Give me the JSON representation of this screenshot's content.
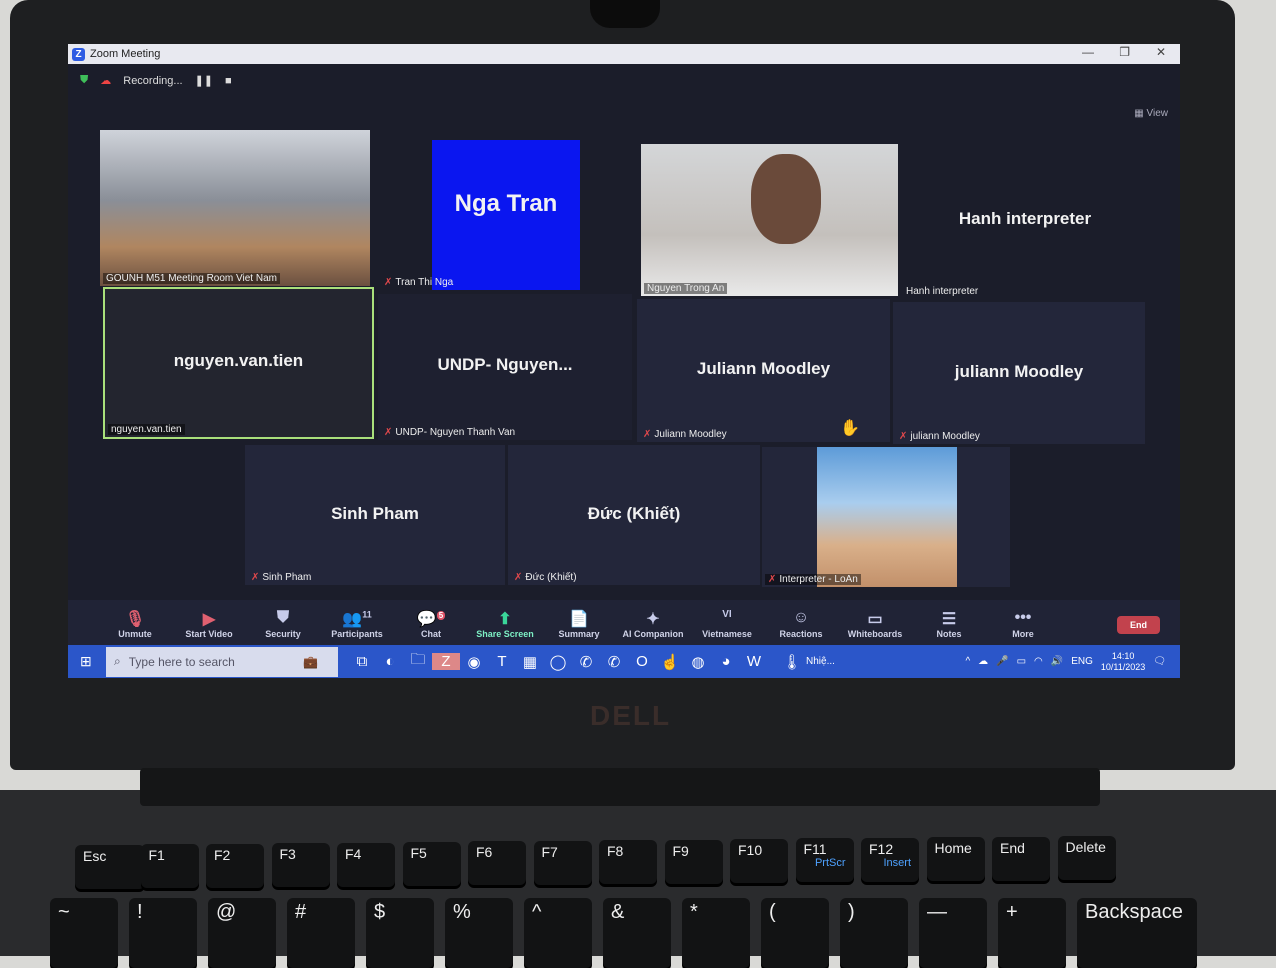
{
  "window": {
    "title": "Zoom Meeting",
    "recording": "Recording...",
    "view_label": "View"
  },
  "tiles": [
    {
      "name": "",
      "label": "GOUNH M51 Meeting Room Viet Nam"
    },
    {
      "name": "Nga Tran",
      "label": "Tran Thi Nga"
    },
    {
      "name": "",
      "label": "Nguyen Trong An"
    },
    {
      "name": "Hanh interpreter",
      "label": "Hanh interpreter"
    },
    {
      "name": "nguyen.van.tien",
      "label": "nguyen.van.tien"
    },
    {
      "name": "UNDP-  Nguyen...",
      "label": "UNDP- Nguyen Thanh Van"
    },
    {
      "name": "Juliann Moodley",
      "label": "Juliann Moodley"
    },
    {
      "name": "juliann Moodley",
      "label": "juliann Moodley"
    },
    {
      "name": "Sinh Pham",
      "label": "Sinh Pham"
    },
    {
      "name": "Đức (Khiết)",
      "label": "Đức (Khiết)"
    },
    {
      "name": "",
      "label": "Interpreter - LoAn"
    }
  ],
  "toolbar": {
    "items": [
      {
        "label": "Unmute",
        "icon": "mic-muted-icon"
      },
      {
        "label": "Start Video",
        "icon": "video-off-icon"
      },
      {
        "label": "Security",
        "icon": "shield-icon"
      },
      {
        "label": "Participants",
        "icon": "participants-icon",
        "count": "11"
      },
      {
        "label": "Chat",
        "icon": "chat-icon",
        "badge": "5"
      },
      {
        "label": "Share Screen",
        "icon": "share-icon"
      },
      {
        "label": "Summary",
        "icon": "summary-icon"
      },
      {
        "label": "AI Companion",
        "icon": "sparkle-icon"
      },
      {
        "label": "Vietnamese",
        "icon": "language-icon",
        "badge": "VI"
      },
      {
        "label": "Reactions",
        "icon": "reactions-icon"
      },
      {
        "label": "Whiteboards",
        "icon": "whiteboard-icon"
      },
      {
        "label": "Notes",
        "icon": "notes-icon"
      },
      {
        "label": "More",
        "icon": "more-icon"
      }
    ],
    "end_label": "End"
  },
  "taskbar": {
    "search_placeholder": "Type here to search",
    "weather": "Nhiệ...",
    "lang": "ENG",
    "time": "14:10",
    "date": "10/11/2023"
  },
  "laptop": {
    "brand": "DELL"
  },
  "keyboard": {
    "frow": [
      "Esc",
      "F1",
      "F2",
      "F3",
      "F4",
      "F5",
      "F6",
      "F7",
      "F8",
      "F9",
      "F10",
      "F11",
      "F12",
      "Home",
      "End",
      "Delete"
    ],
    "frow_sub": [
      "",
      "",
      "",
      "",
      "",
      "",
      "",
      "",
      "",
      "",
      "",
      "PrtScr",
      "Insert",
      "",
      "",
      ""
    ],
    "numrow": [
      "~",
      "!",
      "@",
      "#",
      "$",
      "%",
      "^",
      "&",
      "*",
      "(",
      ")",
      "—",
      "+",
      "Backspace"
    ]
  }
}
